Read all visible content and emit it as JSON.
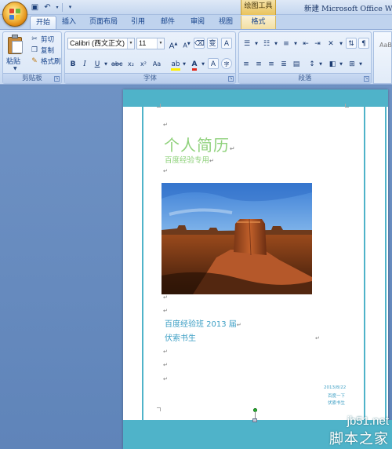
{
  "titlebar": {
    "context_tool": "绘图工具",
    "doc_title": "新建 Microsoft Office Word"
  },
  "tabs": [
    {
      "label": "开始",
      "active": true
    },
    {
      "label": "插入"
    },
    {
      "label": "页面布局"
    },
    {
      "label": "引用"
    },
    {
      "label": "邮件"
    },
    {
      "label": "审阅"
    },
    {
      "label": "视图"
    },
    {
      "label": "格式",
      "contextual": true
    }
  ],
  "ribbon": {
    "clipboard": {
      "paste_label": "粘贴",
      "cut_label": "剪切",
      "copy_label": "复制",
      "format_painter_label": "格式刷",
      "group_label": "剪贴板"
    },
    "font": {
      "font_name": "Calibri (西文正文)",
      "font_size": "11",
      "group_label": "字体",
      "grow_label": "A",
      "shrink_label": "A",
      "bold": "B",
      "italic": "I",
      "underline": "U",
      "strike": "abc",
      "subscript": "x₂",
      "superscript": "x²",
      "change_case": "Aa",
      "char_border": "A",
      "phonetic": "变",
      "char_shading": "A",
      "enclose": "字",
      "font_color": "A"
    },
    "paragraph": {
      "group_label": "段落"
    },
    "styles": {
      "preview": "AaBb"
    }
  },
  "document": {
    "name_title": "个人简历",
    "subtitle": "百度经验专用",
    "class_line": "百度经验班 2013 届",
    "name_line": "伏索书生",
    "mini_lines": [
      "2013/8/22",
      "百度一下",
      "伏索书生"
    ]
  },
  "watermark": {
    "url": "jb51.net",
    "site_name": "脚本之家"
  },
  "colors": {
    "accent_teal": "#4fb3c9",
    "title_green": "#8fd17b",
    "body_blue": "#3b9ec4"
  }
}
